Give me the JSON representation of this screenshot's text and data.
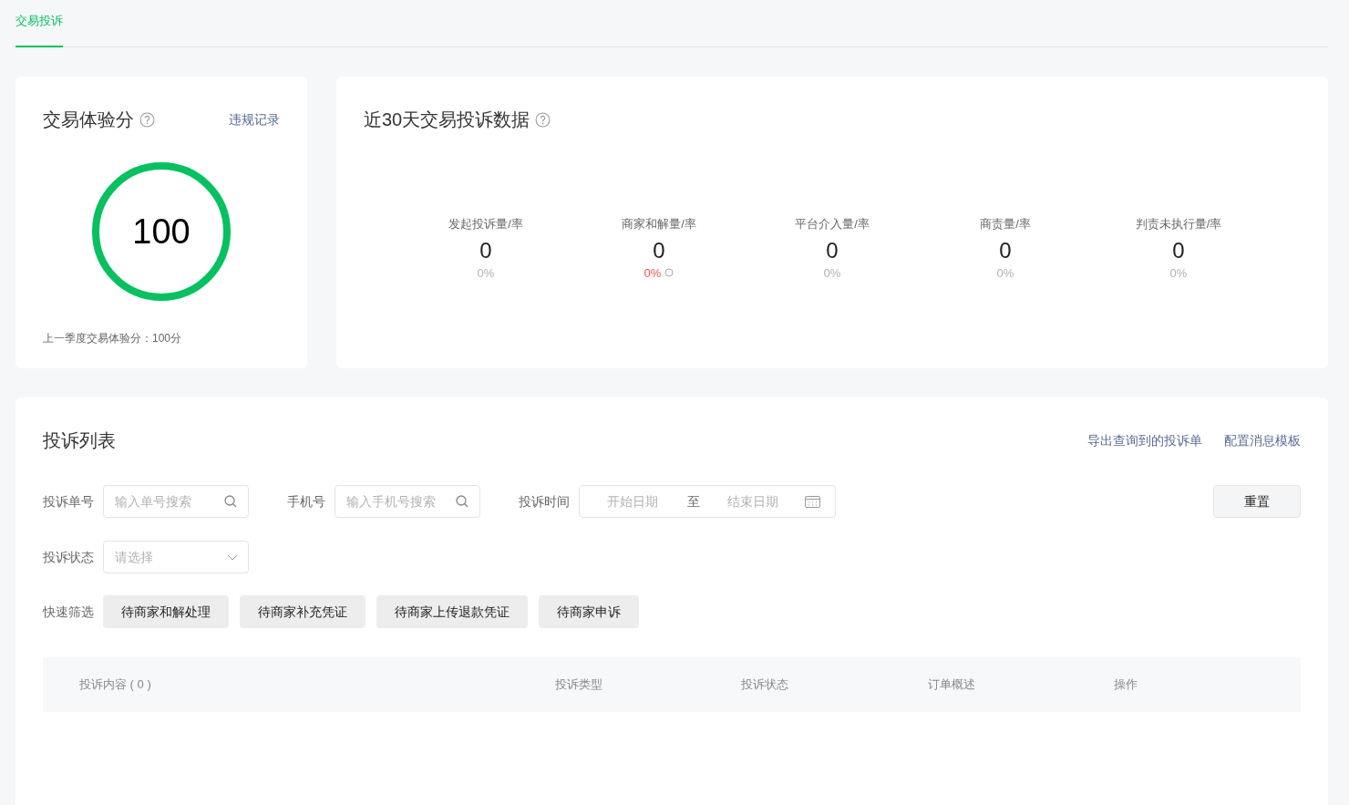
{
  "tabs": [
    {
      "label": "交易投诉",
      "selected": true
    }
  ],
  "score_card": {
    "title": "交易体验分",
    "link": "违规记录",
    "score": "100",
    "level": 1,
    "previous": "上一季度交易体验分：100分"
  },
  "stats_card": {
    "title": "近30天交易投诉数据",
    "stats": [
      {
        "label": "发起投诉量/率",
        "count": "0",
        "rate": "0%",
        "alert": false,
        "pending": false
      },
      {
        "label": "商家和解量/率",
        "count": "0",
        "rate": "0%",
        "alert": true,
        "pending": true
      },
      {
        "label": "平台介入量/率",
        "count": "0",
        "rate": "0%",
        "alert": false,
        "pending": false
      },
      {
        "label": "商责量/率",
        "count": "0",
        "rate": "0%",
        "alert": false,
        "pending": false
      },
      {
        "label": "判责未执行量/率",
        "count": "0",
        "rate": "0%",
        "alert": false,
        "pending": false
      }
    ]
  },
  "list": {
    "title": "投诉列表",
    "actions": [
      "导出查询到的投诉单",
      "配置消息模板"
    ],
    "filters": {
      "order_label": "投诉单号",
      "order_placeholder": "输入单号搜索",
      "phone_label": "手机号",
      "phone_placeholder": "输入手机号搜索",
      "time_label": "投诉时间",
      "start_placeholder": "开始日期",
      "range_sep": "至",
      "end_placeholder": "结束日期",
      "reset": "重置",
      "status_label": "投诉状态",
      "status_placeholder": "请选择",
      "quick_label": "快速筛选"
    },
    "quick_filters": [
      "待商家和解处理",
      "待商家补充凭证",
      "待商家上传退款凭证",
      "待商家申诉"
    ],
    "columns": [
      "投诉内容 ( 0 )",
      "投诉类型",
      "投诉状态",
      "订单概述",
      "操作"
    ]
  }
}
